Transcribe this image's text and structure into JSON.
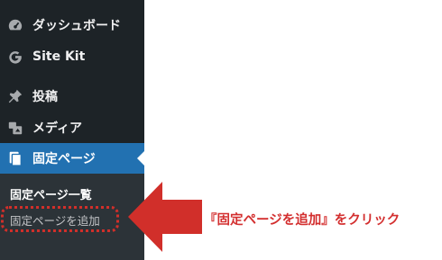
{
  "sidebar": {
    "items": [
      {
        "label": "ダッシュボード",
        "icon": "dashboard-icon"
      },
      {
        "label": "Site Kit",
        "icon": "google-g-icon"
      },
      {
        "label": "投稿",
        "icon": "pin-icon"
      },
      {
        "label": "メディア",
        "icon": "media-icon"
      },
      {
        "label": "固定ページ",
        "icon": "pages-icon",
        "active": true
      }
    ],
    "submenu": {
      "current": "固定ページ一覧",
      "add_new": "固定ページを追加"
    }
  },
  "callout": {
    "text": "『固定ページを追加』をクリック",
    "color": "#d32f2f"
  },
  "colors": {
    "sidebar_bg": "#1d2327",
    "submenu_bg": "#2c3338",
    "active_bg": "#2271b1"
  }
}
